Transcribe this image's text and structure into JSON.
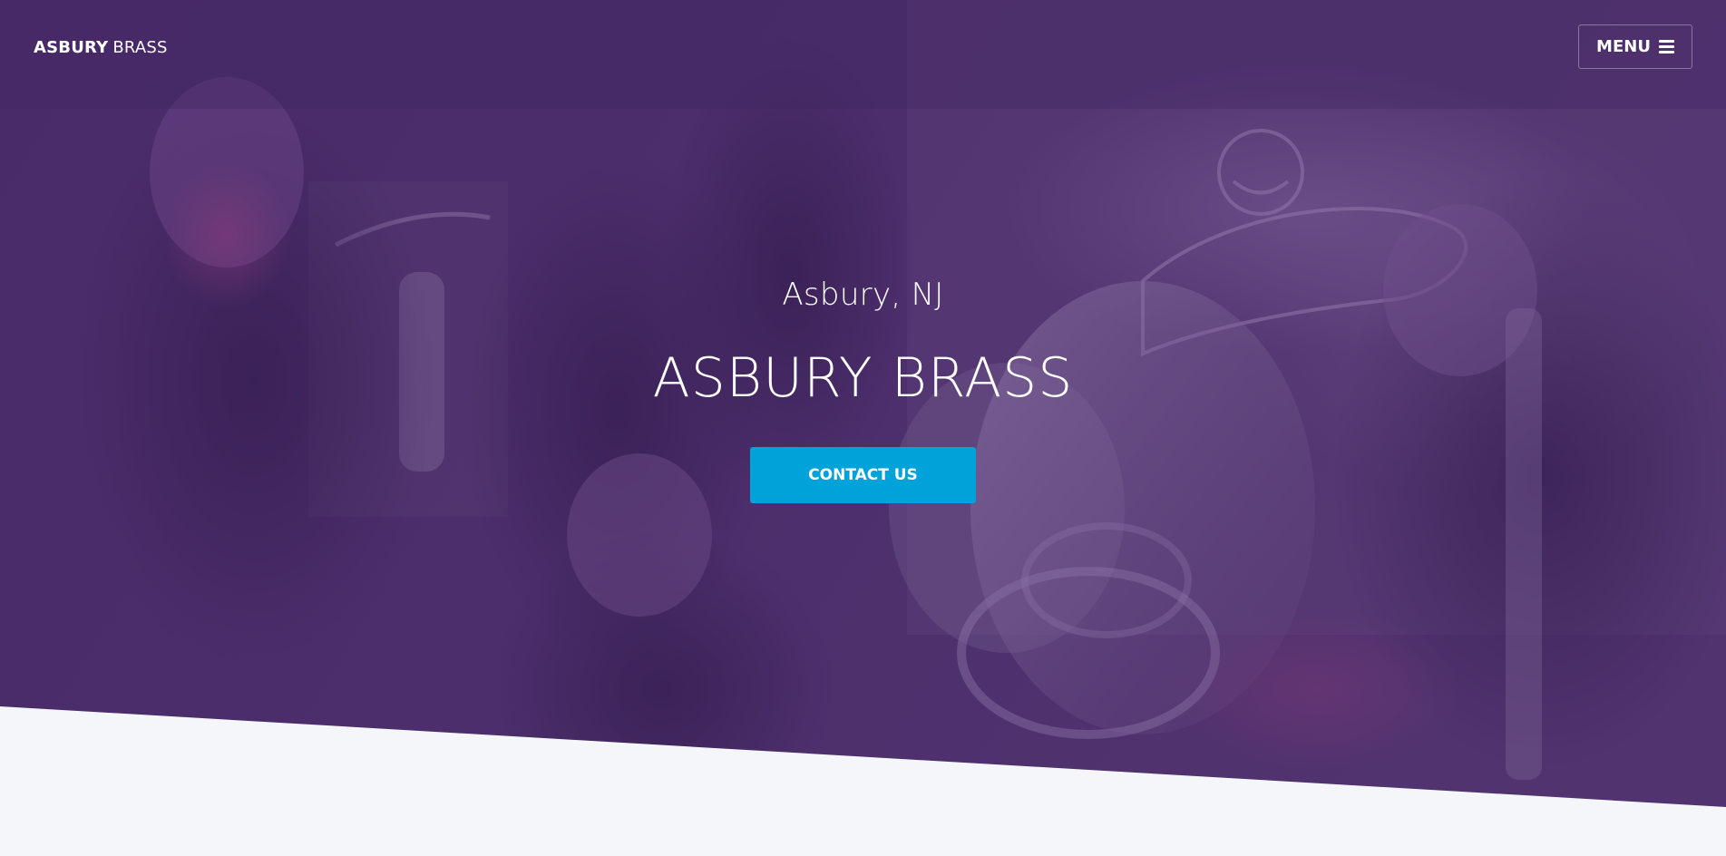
{
  "navbar": {
    "brand_bold": "ASBURY",
    "brand_light": "BRASS",
    "menu_label": "MENU",
    "menu_icon": "hamburger-icon"
  },
  "hero": {
    "location": "Asbury, NJ",
    "title": "ASBURY BRASS",
    "cta_label": "CONTACT US",
    "background_image": "band-photo-purple-overlay"
  },
  "colors": {
    "overlay_purple": "#4a2d6b",
    "accent_blue": "#00a3d9",
    "page_background": "#f4f6fa",
    "text": "#ffffff"
  }
}
